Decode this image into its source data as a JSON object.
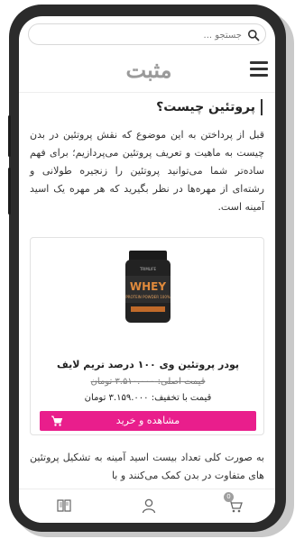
{
  "search": {
    "placeholder": "جستجو ..."
  },
  "header": {
    "logo_text": "مثبت"
  },
  "article": {
    "title": "پروتئین چیست؟",
    "paragraph1": "قبل از پرداختن به این موضوع که نقش پروتئین در بدن چیست به ماهیت و تعریف پروتئین می‌پردازیم؛ برای فهم ساده‌تر شما می‌توانید پروتئین را زنجیره طولانی و رشته‌ای از مهره‌ها در نظر بگیرید که هر مهره یک اسید آمینه است.",
    "paragraph2": "به صورت کلی تعداد بیست اسید آمینه به تشکیل پروتئین های متفاوت در بدن کمک می‌کنند و با"
  },
  "product": {
    "name": "پودر پروتئین وی ۱۰۰ درصد تریم لایف",
    "original_price": "قیمت اصلی: ۳.۵۱۰.۰۰۰ تومان",
    "discount_price": "قیمت با تخفیف: ۳.۱۵۹.۰۰۰ تومان",
    "button_label": "مشاهده و خرید",
    "jar_label": "WHEY",
    "jar_sublabel": "PROTEIN POWDER 100%",
    "jar_brand": "TRIMLIFE"
  },
  "bottom_nav": {
    "cart_count": "0"
  },
  "colors": {
    "accent": "#e91e8c",
    "frame": "#2b2b2b",
    "text": "#333333"
  },
  "icons": [
    "search-icon",
    "menu-icon",
    "cart-icon",
    "book-icon",
    "user-icon",
    "shopping-cart-icon"
  ]
}
